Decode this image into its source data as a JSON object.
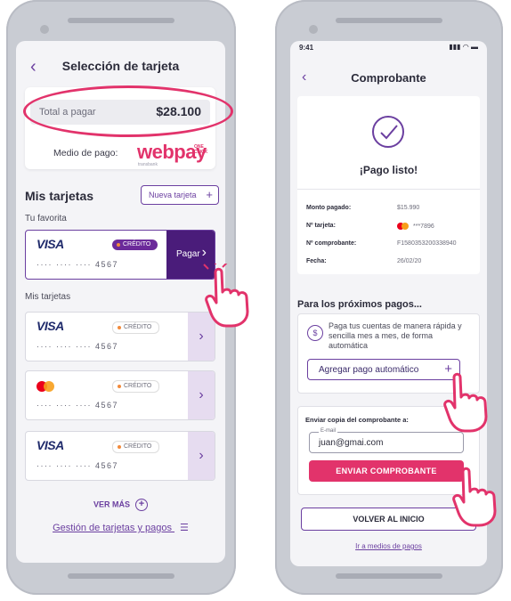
{
  "left": {
    "title": "Selección de tarjeta",
    "total_label": "Total a pagar",
    "total_amount": "$28.100",
    "medio_label": "Medio de pago:",
    "webpay_logo": "webpay",
    "webpay_oneclick": "ONE CLICK",
    "webpay_sub": "transbank",
    "mis_tarjetas": "Mis tarjetas",
    "nueva_tarjeta": "Nueva tarjeta",
    "tu_favorita": "Tu favorita",
    "mis_tarjetas_sub": "Mis tarjetas",
    "favorite_card": {
      "brand": "VISA",
      "badge": "CRÉDITO",
      "number": "···· ···· ···· 4567",
      "action": "Pagar"
    },
    "cards": [
      {
        "brand": "VISA",
        "badge": "CRÉDITO",
        "number": "···· ···· ···· 4567"
      },
      {
        "brand": "mastercard-logo",
        "badge": "CRÉDITO",
        "number": "···· ···· ···· 4567"
      },
      {
        "brand": "VISA",
        "badge": "CRÉDITO",
        "number": "···· ···· ···· 4567"
      }
    ],
    "ver_mas": "VER MÁS",
    "gestion": "Gestión de tarjetas y pagos"
  },
  "right": {
    "time": "9:41",
    "title": "Comprobante",
    "pago_listo": "¡Pago listo!",
    "rows": [
      {
        "k": "Monto pagado:",
        "v": "$15.990"
      },
      {
        "k": "Nº tarjeta:",
        "v": "***7896"
      },
      {
        "k": "Nº comprobante:",
        "v": "F1580353200338940"
      },
      {
        "k": "Fecha:",
        "v": "26/02/20"
      }
    ],
    "next_title": "Para los próximos pagos...",
    "auto_text": "Paga tus cuentas de manera rápida y sencilla mes a mes, de forma automática",
    "auto_btn": "Agregar pago automático",
    "send_label": "Enviar copia del comprobante a:",
    "email_label": "E-mail",
    "email_value": "juan@gmai.com",
    "send_btn": "ENVIAR COMPROBANTE",
    "volver_btn": "VOLVER AL INICIO",
    "ir_medios": "Ir a medios de pagos"
  },
  "colors": {
    "primary": "#6b3fa0",
    "accent": "#e2336b",
    "dark_purple": "#4a1c7a",
    "visa_blue": "#1f2a6b"
  }
}
